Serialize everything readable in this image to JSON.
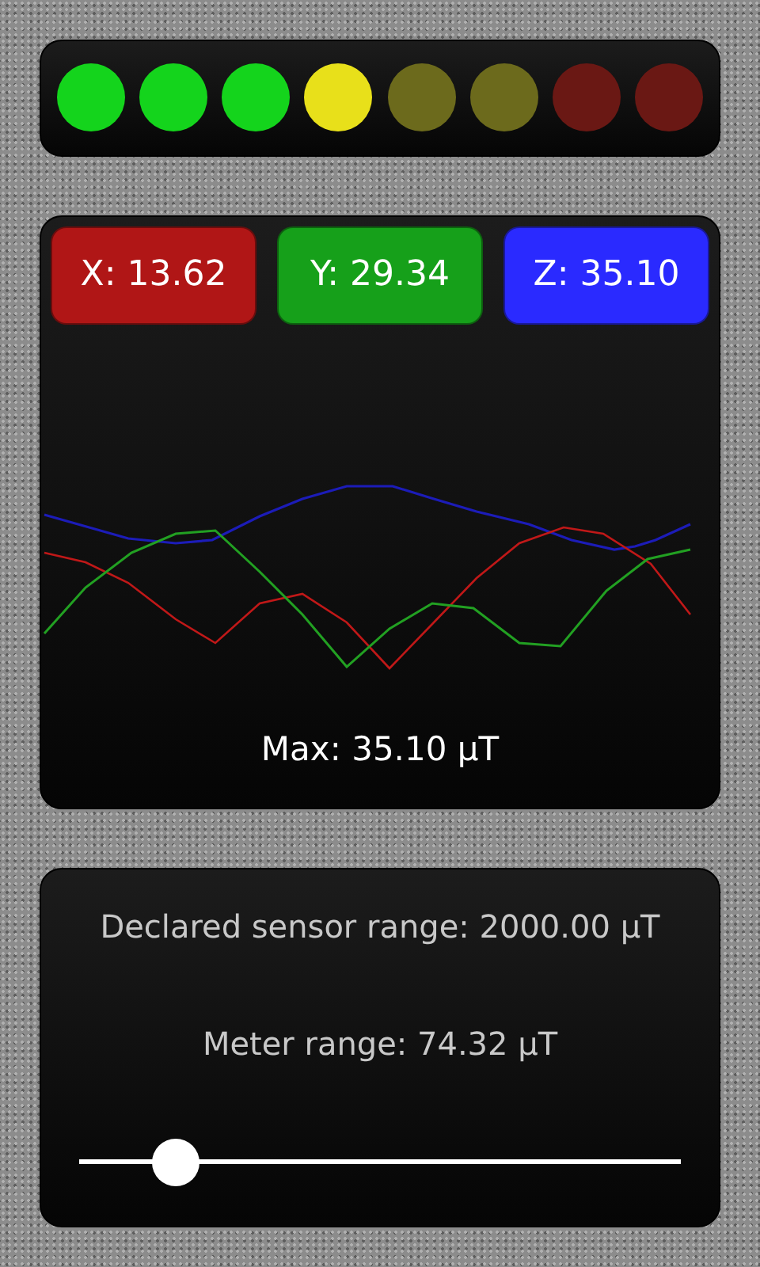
{
  "leds": [
    {
      "color": "#14d41c"
    },
    {
      "color": "#14d41c"
    },
    {
      "color": "#14d41c"
    },
    {
      "color": "#e8e01a"
    },
    {
      "color": "#6c6a1c"
    },
    {
      "color": "#6c6a1c"
    },
    {
      "color": "#6a1814"
    },
    {
      "color": "#6a1814"
    }
  ],
  "axes": [
    {
      "label": "X: 13.62",
      "color": "#b01616"
    },
    {
      "label": "Y: 29.34",
      "color": "#16a01a"
    },
    {
      "label": "Z: 35.10",
      "color": "#2a2aff"
    }
  ],
  "max_reading": "Max: 35.10 μT",
  "declared_range": "Declared sensor range: 2000.00 μT",
  "meter_range": "Meter range: 74.32 μT",
  "range_slider": {
    "level": 0.16
  }
}
